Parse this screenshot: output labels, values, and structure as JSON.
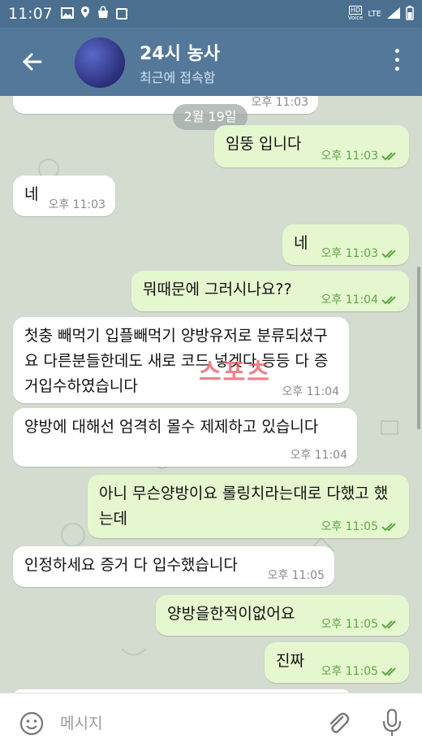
{
  "status_bar": {
    "time": "11:07",
    "hd_label": "HD",
    "voice_label": "Voice",
    "lte_label": "LTE"
  },
  "header": {
    "title": "24시 농사",
    "subtitle": "최근에 접속함"
  },
  "chat": {
    "date_divider": "2월 19일",
    "messages": [
      {
        "dir": "in",
        "text": "",
        "time": "오후 11:03"
      },
      {
        "dir": "out",
        "text": "임뚱 입니다",
        "time": "오후 11:03"
      },
      {
        "dir": "in",
        "text": "네",
        "time": "오후 11:03"
      },
      {
        "dir": "out",
        "text": "네",
        "time": "오후 11:03"
      },
      {
        "dir": "out",
        "text": "뭐때문에 그러시나요??",
        "time": "오후 11:04"
      },
      {
        "dir": "in",
        "text": "첫충 빼먹기 입플빼먹기 양방유저로 분류되셨구요 다른분들한데도 새로 코드 넣겟다 등등 다 증거입수하였습니다",
        "time": "오후 11:04"
      },
      {
        "dir": "in",
        "text": "양방에 대해선 엄격히 몰수 제제하고 있습니다",
        "time": "오후 11:04"
      },
      {
        "dir": "out",
        "text": "아니 무슨양방이요 롤링치라는대로 다했고 했는데",
        "time": "오후 11:05"
      },
      {
        "dir": "in",
        "text": "인정하세요 증거 다 입수했습니다",
        "time": "오후 11:05"
      },
      {
        "dir": "out",
        "text": "양방을한적이없어요",
        "time": "오후 11:05"
      },
      {
        "dir": "out",
        "text": "진짜",
        "time": "오후 11:05"
      }
    ],
    "watermark": "스포츠"
  },
  "input": {
    "placeholder": "메시지"
  },
  "colors": {
    "header": "#54789a",
    "statusbar": "#4a6f8f",
    "outgoing": "#e5f7cf",
    "incoming": "#ffffff",
    "check": "#5fa845"
  }
}
